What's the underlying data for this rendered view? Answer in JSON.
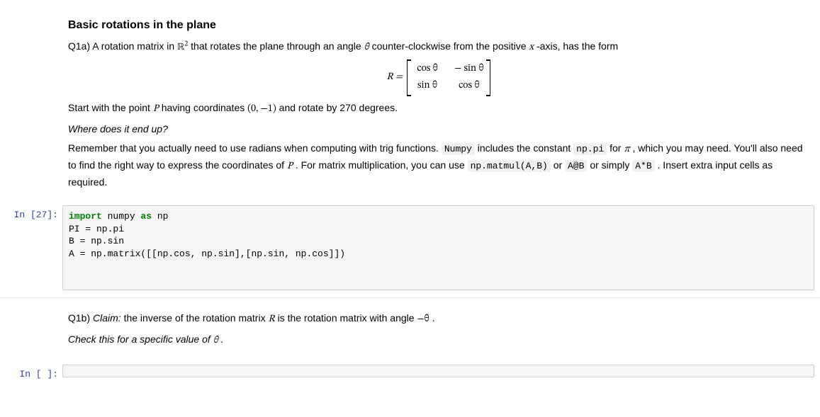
{
  "md1": {
    "heading": "Basic rotations in the plane",
    "q1a_lead_a": "Q1a) A rotation matrix in ",
    "R2": "ℝ",
    "R2_exp": "2",
    "q1a_lead_b": " that rotates the plane through an angle ",
    "theta": "θ",
    "q1a_lead_c": " counter-clockwise from the positive ",
    "xvar": "x",
    "q1a_lead_d": "-axis, has the form",
    "eq_lhs": "R =",
    "m11": "cos θ",
    "m12": "− sin θ",
    "m21": "sin θ",
    "m22": "cos θ",
    "p2_a": "Start with the point ",
    "Pvar": "P",
    "p2_b": " having coordinates ",
    "coords": "(0, −1)",
    "p2_c": " and rotate by 270 degrees.",
    "p3": "Where does it end up?",
    "p4_a": "Remember that you actually need to use radians when computing with trig functions. ",
    "c_numpy": "Numpy",
    "p4_b": " includes the constant ",
    "c_nppi": "np.pi",
    "p4_c": " for ",
    "pi_sym": "π",
    "p4_d": ", which you may need. You'll also need to find the right way to express the coordinates of ",
    "p4_e": ". For matrix multiplication, you can use ",
    "c_matmul": "np.matmul(A,B)",
    "p4_f": " or ",
    "c_at": "A@B",
    "p4_g": " or simply ",
    "c_mul": "A*B",
    "p4_h": " . Insert extra input cells as required."
  },
  "code1": {
    "prompt": "In [27]:",
    "l1_a": "import",
    "l1_b": " numpy ",
    "l1_c": "as",
    "l1_d": " np",
    "l2": "PI = np.pi",
    "l3": "B = np.sin",
    "l4": "A = np.matrix([[np.cos, np.sin],[np.sin, np.cos]])"
  },
  "md2": {
    "q1b_a": "Q1b) ",
    "claim_label": "Claim:",
    "q1b_b": " the inverse of the rotation matrix ",
    "Rvar": "R",
    "q1b_c": " is the rotation matrix with angle ",
    "neg_theta": "−θ",
    "q1b_d": ".",
    "check_a": "Check this for a specific value of ",
    "theta": "θ",
    "check_b": "."
  },
  "code2": {
    "prompt": "In [ ]:",
    "body": ""
  }
}
